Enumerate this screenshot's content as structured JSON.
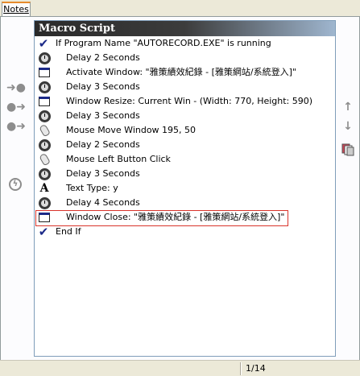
{
  "tabs": [
    {
      "label": "Notes"
    }
  ],
  "macro": {
    "title": "Macro Script",
    "lines": [
      {
        "icon": "check-icon",
        "level": 0,
        "text": "If Program Name \"AUTORECORD.EXE\" is running"
      },
      {
        "icon": "alarm-clock-icon",
        "level": 1,
        "text": "Delay 2 Seconds"
      },
      {
        "icon": "window-icon",
        "level": 1,
        "text": "Activate Window: \"雅策績效紀錄 - [雅策網站/系統登入]\""
      },
      {
        "icon": "alarm-clock-icon",
        "level": 1,
        "text": "Delay 3 Seconds"
      },
      {
        "icon": "window-icon",
        "level": 1,
        "text": "Window Resize: Current Win - (Width: 770, Height: 590)"
      },
      {
        "icon": "alarm-clock-icon",
        "level": 1,
        "text": "Delay 3 Seconds"
      },
      {
        "icon": "mouse-icon",
        "level": 1,
        "text": "Mouse Move Window 195, 50"
      },
      {
        "icon": "alarm-clock-icon",
        "level": 1,
        "text": "Delay 2 Seconds"
      },
      {
        "icon": "mouse-icon",
        "level": 1,
        "text": "Mouse Left Button Click"
      },
      {
        "icon": "alarm-clock-icon",
        "level": 1,
        "text": "Delay 3 Seconds"
      },
      {
        "icon": "letter-a-icon",
        "level": 1,
        "text": "Text Type: y"
      },
      {
        "icon": "alarm-clock-icon",
        "level": 1,
        "text": "Delay 4 Seconds"
      },
      {
        "icon": "window-icon",
        "level": 1,
        "text": "Window Close: \"雅策績效紀錄 - [雅策網站/系統登入]\"",
        "selected": true
      },
      {
        "icon": "check-icon",
        "level": 0,
        "text": "End If"
      }
    ]
  },
  "status": {
    "page": "1/14"
  },
  "colors": {
    "selection_border": "#d9342b",
    "header_dark": "#2a2a2a",
    "header_light": "#9fb6cf",
    "check_blue": "#1c2a88"
  }
}
